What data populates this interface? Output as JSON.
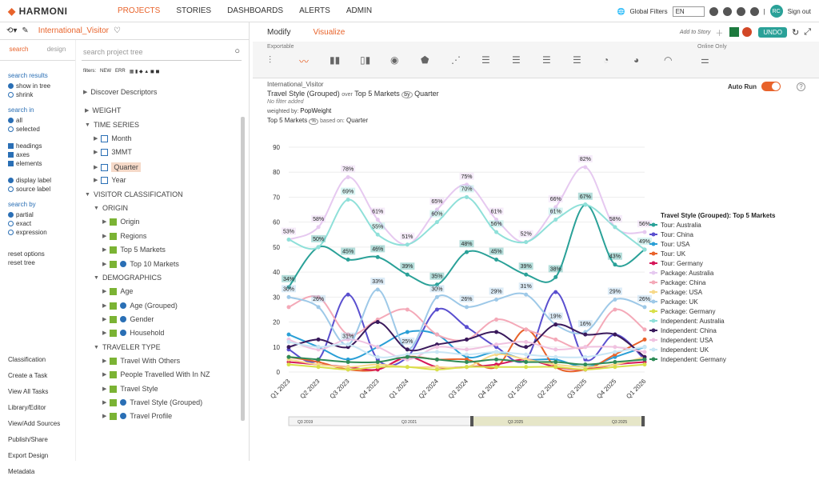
{
  "app": {
    "logo": "HARMONI",
    "nav": [
      "PROJECTS",
      "STORIES",
      "DASHBOARDS",
      "ALERTS",
      "ADMIN"
    ],
    "global_filters": "Global Filters",
    "lang": "EN",
    "user": "RC",
    "signout": "Sign out"
  },
  "left": {
    "title": "International_Visitor",
    "tab_search": "search",
    "tab_design": "design",
    "search_placeholder": "search project tree",
    "filters_label": "filters:",
    "filters": [
      "NEW",
      "ERR"
    ],
    "discover": "Discover Descriptors",
    "options": {
      "h_results": "search results",
      "results": [
        "show in tree",
        "shrink"
      ],
      "h_in": "search in",
      "in": [
        "all",
        "selected"
      ],
      "fields": [
        "headings",
        "axes",
        "elements"
      ],
      "labels": [
        "display label",
        "source label"
      ],
      "h_by": "search by",
      "by": [
        "partial",
        "exact",
        "expression"
      ],
      "reset_options": "reset options",
      "reset_tree": "reset tree"
    },
    "links": [
      "Classification",
      "Create a Task",
      "View All Tasks",
      "Library/Editor",
      "View/Add Sources",
      "Publish/Share",
      "Export Design",
      "Metadata"
    ],
    "tree": [
      "WEIGHT",
      "TIME SERIES",
      "Month",
      "3MMT",
      "Quarter",
      "Year",
      "VISITOR CLASSIFICATION",
      "ORIGIN",
      "Origin",
      "Regions",
      "Top 5 Markets",
      "Top 10 Markets",
      "DEMOGRAPHICS",
      "Age",
      "Age (Grouped)",
      "Gender",
      "Household",
      "TRAVELER TYPE",
      "Travel With Others",
      "People Travelled With In NZ",
      "Travel Style",
      "Travel Style (Grouped)",
      "Travel Profile"
    ]
  },
  "right": {
    "tab_modify": "Modify",
    "tab_visualize": "Visualize",
    "add_to_story": "Add to Story",
    "undo": "UNDO",
    "exportable": "Exportable",
    "online_only": "Online Only",
    "info": {
      "name": "International_Visitor",
      "t1": "Travel Style (Grouped)",
      "over": "over",
      "t2": "Top 5 Markets",
      "by": "Quarter",
      "nofilter": "No filter added",
      "weighted_label": "weighted by:",
      "weighted": "PopWeight",
      "based1": "Top 5 Markets",
      "based_on": "based on:",
      "based2": "Quarter"
    },
    "autorun": "Auto Run"
  },
  "chart_data": {
    "type": "line",
    "categories": [
      "Q1 2023",
      "Q2 2023",
      "Q3 2023",
      "Q4 2023",
      "Q1 2024",
      "Q2 2024",
      "Q3 2024",
      "Q4 2024",
      "Q1 2025",
      "Q2 2025",
      "Q3 2025",
      "Q4 2025",
      "Q1 2026"
    ],
    "ylim": [
      0,
      90
    ],
    "yticks": [
      0,
      10,
      20,
      30,
      40,
      50,
      60,
      70,
      80,
      90
    ],
    "legend_title": "Travel Style (Grouped): Top 5 Markets",
    "series": [
      {
        "name": "Tour: Australia",
        "color": "#2aa198",
        "values": [
          34,
          50,
          45,
          46,
          39,
          35,
          48,
          45,
          39,
          38,
          67,
          43,
          49
        ]
      },
      {
        "name": "Tour: China",
        "color": "#5a4fcf",
        "values": [
          9,
          5,
          31,
          5,
          6,
          25,
          18,
          10,
          5,
          32,
          5,
          15,
          5
        ]
      },
      {
        "name": "Tour: USA",
        "color": "#2a9fd6",
        "values": [
          15,
          10,
          5,
          10,
          16,
          15,
          6,
          8,
          5,
          5,
          2,
          6,
          10
        ]
      },
      {
        "name": "Tour: UK",
        "color": "#e8632b",
        "values": [
          6,
          4,
          1,
          1,
          6,
          5,
          5,
          2,
          17,
          2,
          1,
          7,
          13
        ]
      },
      {
        "name": "Tour: Germany",
        "color": "#d6185a",
        "values": [
          4,
          3,
          2,
          1,
          6,
          2,
          2,
          3,
          5,
          2,
          1,
          3,
          4
        ]
      },
      {
        "name": "Package: Australia",
        "color": "#e6c9f0",
        "values": [
          53,
          58,
          78,
          61,
          51,
          65,
          75,
          61,
          52,
          66,
          82,
          58,
          56
        ]
      },
      {
        "name": "Package: China",
        "color": "#f4a9b8",
        "values": [
          26,
          30,
          15,
          21,
          25,
          15,
          13,
          21,
          17,
          13,
          10,
          25,
          17
        ]
      },
      {
        "name": "Package: USA",
        "color": "#f7d98a",
        "values": [
          5,
          3,
          2,
          3,
          2,
          2,
          2,
          7,
          5,
          3,
          2,
          3,
          6
        ]
      },
      {
        "name": "Package: UK",
        "color": "#9ec9e8",
        "values": [
          30,
          26,
          11,
          33,
          9,
          30,
          26,
          29,
          31,
          19,
          16,
          29,
          26
        ]
      },
      {
        "name": "Package: Germany",
        "color": "#d8e04a",
        "values": [
          3,
          2,
          1,
          2,
          2,
          1,
          2,
          2,
          2,
          2,
          1,
          2,
          3
        ]
      },
      {
        "name": "Independent: Australia",
        "color": "#8fe0d9",
        "values": [
          53,
          50,
          69,
          55,
          51,
          60,
          70,
          56,
          52,
          61,
          67,
          58,
          49
        ]
      },
      {
        "name": "Independent: China",
        "color": "#3a1a5c",
        "values": [
          10,
          13,
          10,
          20,
          9,
          11,
          13,
          16,
          10,
          19,
          15,
          15,
          6
        ]
      },
      {
        "name": "Independent: USA",
        "color": "#f0c2e0",
        "values": [
          13,
          9,
          13,
          10,
          5,
          10,
          9,
          11,
          12,
          9,
          10,
          10,
          8
        ]
      },
      {
        "name": "Independent: UK",
        "color": "#c9e6f5",
        "values": [
          12,
          10,
          11,
          6,
          7,
          8,
          7,
          8,
          7,
          6,
          6,
          8,
          10
        ]
      },
      {
        "name": "Independent: Germany",
        "color": "#2e8b57",
        "values": [
          6,
          5,
          4,
          4,
          6,
          5,
          4,
          5,
          4,
          4,
          3,
          4,
          5
        ]
      }
    ],
    "labeled": [
      {
        "s": 0,
        "labels": [
          "34%",
          "50%",
          "45%",
          "46%",
          "39%",
          "35%",
          "48%",
          "45%",
          "39%",
          "38%",
          "67%",
          "43%",
          ""
        ]
      },
      {
        "s": 5,
        "labels": [
          "53%",
          "58%",
          "78%",
          "61%",
          "51%",
          "65%",
          "75%",
          "61%",
          "52%",
          "66%",
          "82%",
          "58%",
          "56%"
        ]
      },
      {
        "s": 10,
        "labels": [
          "",
          "",
          "69%",
          "55%",
          "",
          "60%",
          "70%",
          "56%",
          "",
          "61%",
          "",
          "",
          "49%"
        ]
      },
      {
        "s": 8,
        "labels": [
          "30%",
          "26%",
          "31%",
          "33%",
          "25%",
          "30%",
          "26%",
          "29%",
          "31%",
          "19%",
          "16%",
          "29%",
          "26%"
        ]
      }
    ],
    "range_labels": [
      "Q3 2019",
      "Q3 2021",
      "Q3 2025",
      "Q3 2025"
    ]
  }
}
